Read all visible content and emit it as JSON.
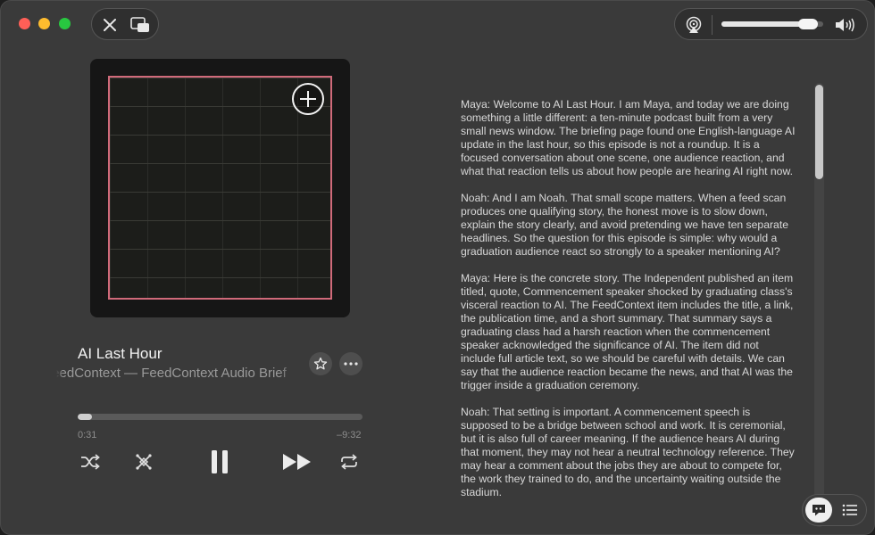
{
  "window": {
    "controls": [
      "close",
      "minimize",
      "zoom"
    ]
  },
  "toolbar": {
    "close_icon": "close-icon",
    "miniplayer_icon": "miniplayer-icon",
    "airplay_icon": "airplay-icon",
    "volume_icon": "speaker-icon",
    "volume_level": 0.85
  },
  "now_playing": {
    "title": "AI Last Hour",
    "subtitle": "FeedContext — FeedContext Audio Brief",
    "elapsed": "0:31",
    "remaining": "–9:32",
    "progress": 0.05,
    "artwork_accent": "#d06a7a"
  },
  "controls": {
    "shuffle_icon": "shuffle-icon",
    "crossfade_icon": "crossfade-icon",
    "pause_icon": "pause-icon",
    "forward_icon": "fast-forward-icon",
    "repeat_icon": "repeat-icon",
    "favorite_icon": "star-icon",
    "more_icon": "more-icon"
  },
  "transcript": {
    "paragraphs": [
      "Maya: Welcome to AI Last Hour. I am Maya, and today we are doing something a little different: a ten-minute podcast built from a very small news window. The briefing page found one English-language AI update in the last hour, so this episode is not a roundup. It is a focused conversation about one scene, one audience reaction, and what that reaction tells us about how people are hearing AI right now.",
      "Noah: And I am Noah. That small scope matters. When a feed scan produces one qualifying story, the honest move is to slow down, explain the story clearly, and avoid pretending we have ten separate headlines. So the question for this episode is simple: why would a graduation audience react so strongly to a speaker mentioning AI?",
      "Maya: Here is the concrete story. The Independent published an item titled, quote, Commencement speaker shocked by graduating class's visceral reaction to AI. The FeedContext item includes the title, a link, the publication time, and a short summary. That summary says a graduating class had a harsh reaction when the commencement speaker acknowledged the significance of AI. The item did not include full article text, so we should be careful with details. We can say that the audience reaction became the news, and that AI was the trigger inside a graduation ceremony.",
      "Noah: That setting is important. A commencement speech is supposed to be a bridge between school and work. It is ceremonial, but it is also full of career meaning. If the audience hears AI during that moment, they may not hear a neutral technology reference. They may hear a comment about the jobs they are about to compete for, the work they trained to do, and the uncertainty waiting outside the stadium."
    ]
  },
  "bottom_bar": {
    "lyrics_icon": "lyrics-icon",
    "queue_icon": "queue-icon"
  }
}
